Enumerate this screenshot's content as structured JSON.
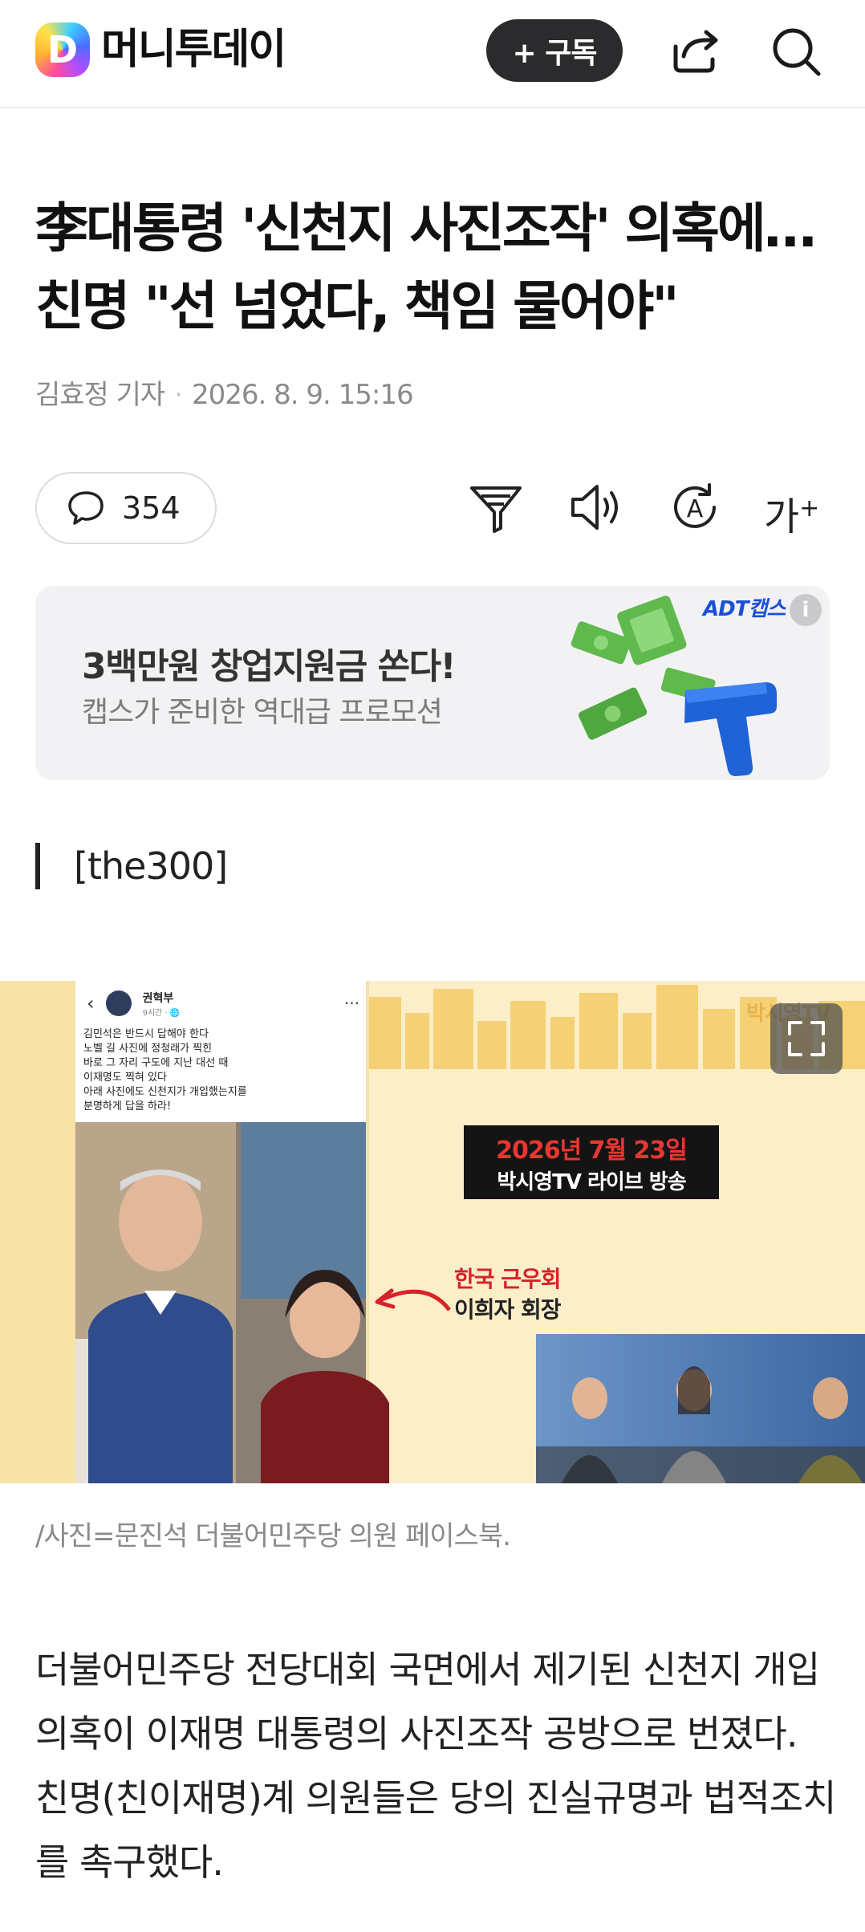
{
  "header": {
    "logo_letter": "D",
    "brand": "머니투데이",
    "subscribe_label": "+ 구독",
    "share_icon": "share-icon",
    "search_icon": "search-icon"
  },
  "article": {
    "title": "李대통령 '신천지 사진조작' 의혹에…친명 \"선 넘었다, 책임 물어야\"",
    "author": "김효정 기자",
    "date": "2026. 8. 9. 15:16",
    "comment_count": "354",
    "font_size_label": "가",
    "section": "[the300]"
  },
  "ad": {
    "brand": "ADT캡스",
    "info": "i",
    "title": "3백만원 창업지원금 쏜다!",
    "subtitle": "캡스가 준비한 역대급 프로모션"
  },
  "photo": {
    "post_author": "권혁부",
    "post_time": "9시간 · 🌐",
    "post_lines": [
      "김민석은 반드시 답해야 한다",
      "노벨 길 사진에 정청래가 찍힌",
      "바로 그 자리 구도에 지난 대선 때",
      "이재명도 찍혀 있다",
      "아래 사진에도 신천지가 개입했는지를",
      "분명하게 답을 하라!"
    ],
    "date_banner": "2026년 7월 23일",
    "broadcast": "박시영TV 라이브 방송",
    "annotation_1": "한국 근우회",
    "annotation_2": "이희자 회장",
    "watermark": "박시영TV",
    "caption": "/사진=문진석 더불어민주당 의원 페이스북."
  },
  "body": {
    "paragraph_1": "더불어민주당 전당대회 국면에서 제기된 신천지 개입 의혹이 이재명 대통령의 사진조작 공방으로 번졌다. 친명(친이재명)계 의원들은 당의 진실규명과 법적조치를 촉구했다."
  },
  "colors": {
    "subscribe_bg": "#2b2b2d",
    "ad_bg": "#f2f2f4",
    "photo_bg": "#f8e7b7",
    "accent_red": "#d8222a"
  }
}
